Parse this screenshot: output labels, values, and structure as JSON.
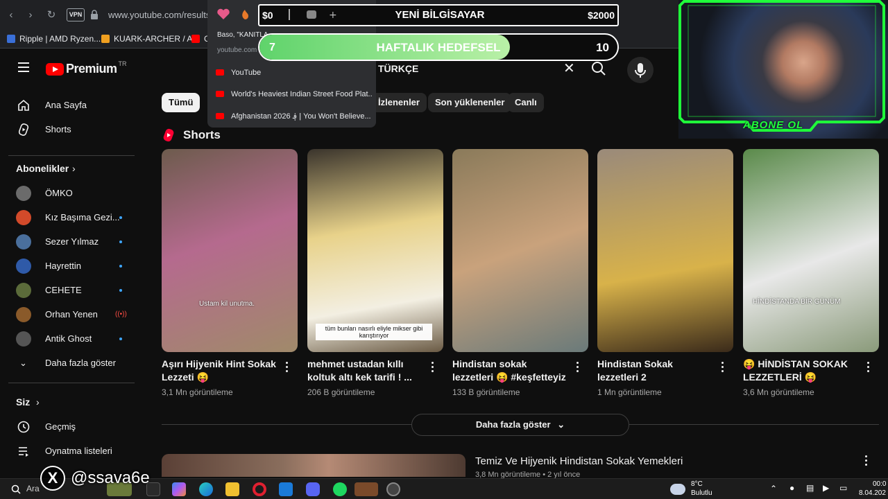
{
  "browser": {
    "url": "www.youtube.com/results",
    "vpn_label": "VPN",
    "bookmarks": [
      "Ripple | AMD Ryzen...",
      "KUARK-ARCHER / A...",
      "G"
    ]
  },
  "history_dropdown": {
    "meta_title": "Baso, \"KANITLA...",
    "meta_domain": "youtube.com",
    "rows": [
      "YouTube",
      "World's Heaviest Indian Street Food Plat...",
      "Afghanistan 2026 ؋ | You Won't Believe..."
    ]
  },
  "header": {
    "logo_text": "Premium",
    "logo_region": "TR",
    "search_query": "TÜRKÇE"
  },
  "sidebar": {
    "main": [
      {
        "label": "Ana Sayfa",
        "icon": "home-icon"
      },
      {
        "label": "Shorts",
        "icon": "shorts-icon"
      }
    ],
    "subscriptions_heading": "Abonelikler",
    "subscriptions": [
      {
        "label": "ÖMKO",
        "avatar_color": "#6b6b6b",
        "status": ""
      },
      {
        "label": "Kız Başıma Gezi...",
        "avatar_color": "#d24a2a",
        "status": "new"
      },
      {
        "label": "Sezer Yılmaz",
        "avatar_color": "#4a6f9c",
        "status": "new"
      },
      {
        "label": "Hayrettin",
        "avatar_color": "#2f5aa8",
        "status": "new"
      },
      {
        "label": "CEHETE",
        "avatar_color": "#5b6b3a",
        "status": "new"
      },
      {
        "label": "Orhan Yenen",
        "avatar_color": "#8a5a2a",
        "status": "live"
      },
      {
        "label": "Antik Ghost",
        "avatar_color": "#555555",
        "status": "new"
      }
    ],
    "show_more": "Daha fazla göster",
    "you_heading": "Siz",
    "you_items": [
      {
        "label": "Geçmiş",
        "icon": "history-icon"
      },
      {
        "label": "Oynatma listeleri",
        "icon": "playlist-icon"
      }
    ]
  },
  "chips": [
    "Tümü",
    "İzlenenler",
    "Son yüklenenler",
    "Canlı"
  ],
  "shorts": {
    "heading": "Shorts",
    "items": [
      {
        "title": "Aşırı Hijyenik Hint Sokak Lezzeti 😝",
        "views": "3,1 Mn görüntileme",
        "overlay": "Ustam kil unutma.",
        "colors": [
          "#6d5b4d",
          "#b56a8e",
          "#a08a6a"
        ]
      },
      {
        "title": "mehmet ustadan kıllı koltuk altı kek tarifi ! ...",
        "views": "206 B görüntileme",
        "overlay": "tüm bunları nasırlı eliyle mikser gibi karıştırıyor",
        "colors": [
          "#3a342c",
          "#e8d28a",
          "#f3efe2"
        ]
      },
      {
        "title": "Hindistan sokak lezzetleri 😝 #keşfetteyiz #kome...",
        "views": "133 B görüntileme",
        "overlay": "",
        "colors": [
          "#8a7a5a",
          "#c9a27c",
          "#6a7a7a"
        ]
      },
      {
        "title": "Hindistan Sokak lezzetleri 2",
        "views": "1 Mn görüntileme",
        "overlay": "",
        "colors": [
          "#9a8a7a",
          "#d8b24a",
          "#3a2a1a"
        ]
      },
      {
        "title": "😝 HİNDİSTAN SOKAK LEZZETLERİ 😝",
        "views": "3,6 Mn görüntileme",
        "overlay": "HİNDİSTANDA BİR GÜNÜM",
        "colors": [
          "#5a8a4a",
          "#e8e8e8",
          "#8a9a7a"
        ]
      }
    ],
    "show_more": "Daha fazla göster"
  },
  "video": {
    "title": "Temiz Ve Hijyenik Hindistan Sokak Yemekleri",
    "meta": "3,8 Mn görüntileme • 2 yıl önce"
  },
  "stream": {
    "goal_top_left": "$0",
    "goal_top_center": "YENİ BİLGİSAYAR",
    "goal_top_right": "$2000",
    "goal_week_left": "7",
    "goal_week_center": "HAFTALIK HEDEFSEL",
    "goal_week_right": "10",
    "goal_week_progress": 0.7,
    "abone": "ABONE OL",
    "handle": "@ssava6e",
    "accent": "#1fff3a"
  },
  "taskbar": {
    "search": "Ara",
    "weather_temp": "8°C",
    "weather_text": "Bulutlu",
    "time": "00:0",
    "date": "8.04.202"
  }
}
